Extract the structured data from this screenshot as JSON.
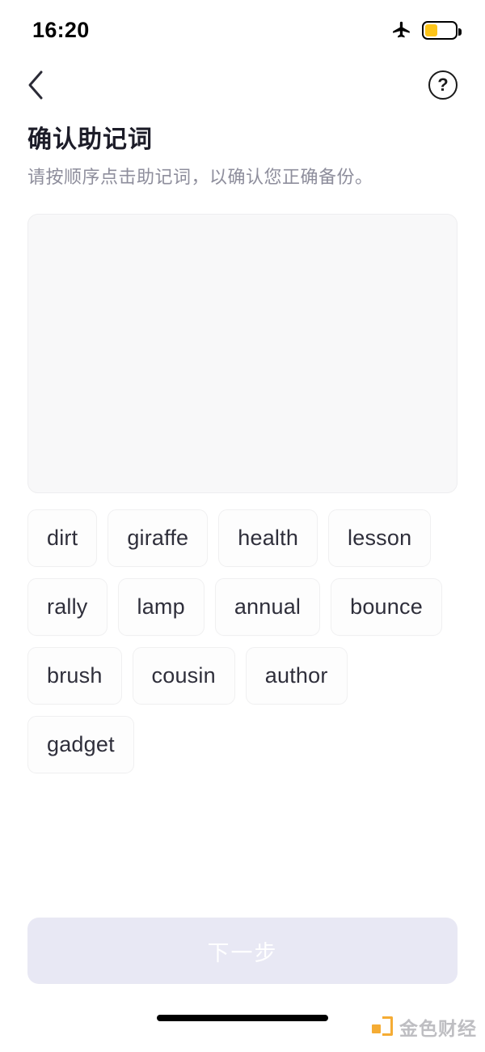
{
  "status_bar": {
    "time": "16:20",
    "airplane_icon": "airplane-icon",
    "battery_icon": "battery-icon",
    "battery_level_percent": 42,
    "battery_color": "#fcc419"
  },
  "nav_bar": {
    "back_icon": "chevron-left-icon",
    "help_icon": "question-mark-circle-icon",
    "help_label": "?"
  },
  "header": {
    "title": "确认助记词",
    "subtitle": "请按顺序点击助记词，以确认您正确备份。"
  },
  "answer_area": {
    "selected_words": [],
    "background_color": "#f8f8f9",
    "border_color": "#eeeef0"
  },
  "word_pool": {
    "words": [
      "dirt",
      "giraffe",
      "health",
      "lesson",
      "rally",
      "lamp",
      "annual",
      "bounce",
      "brush",
      "cousin",
      "author",
      "gadget"
    ]
  },
  "footer": {
    "next_label": "下一步",
    "next_enabled": false,
    "next_background_color": "#e8e8f4",
    "next_text_color": "#ffffff"
  },
  "watermark": {
    "text": "金色财经",
    "logo_color": "#f5a623"
  }
}
